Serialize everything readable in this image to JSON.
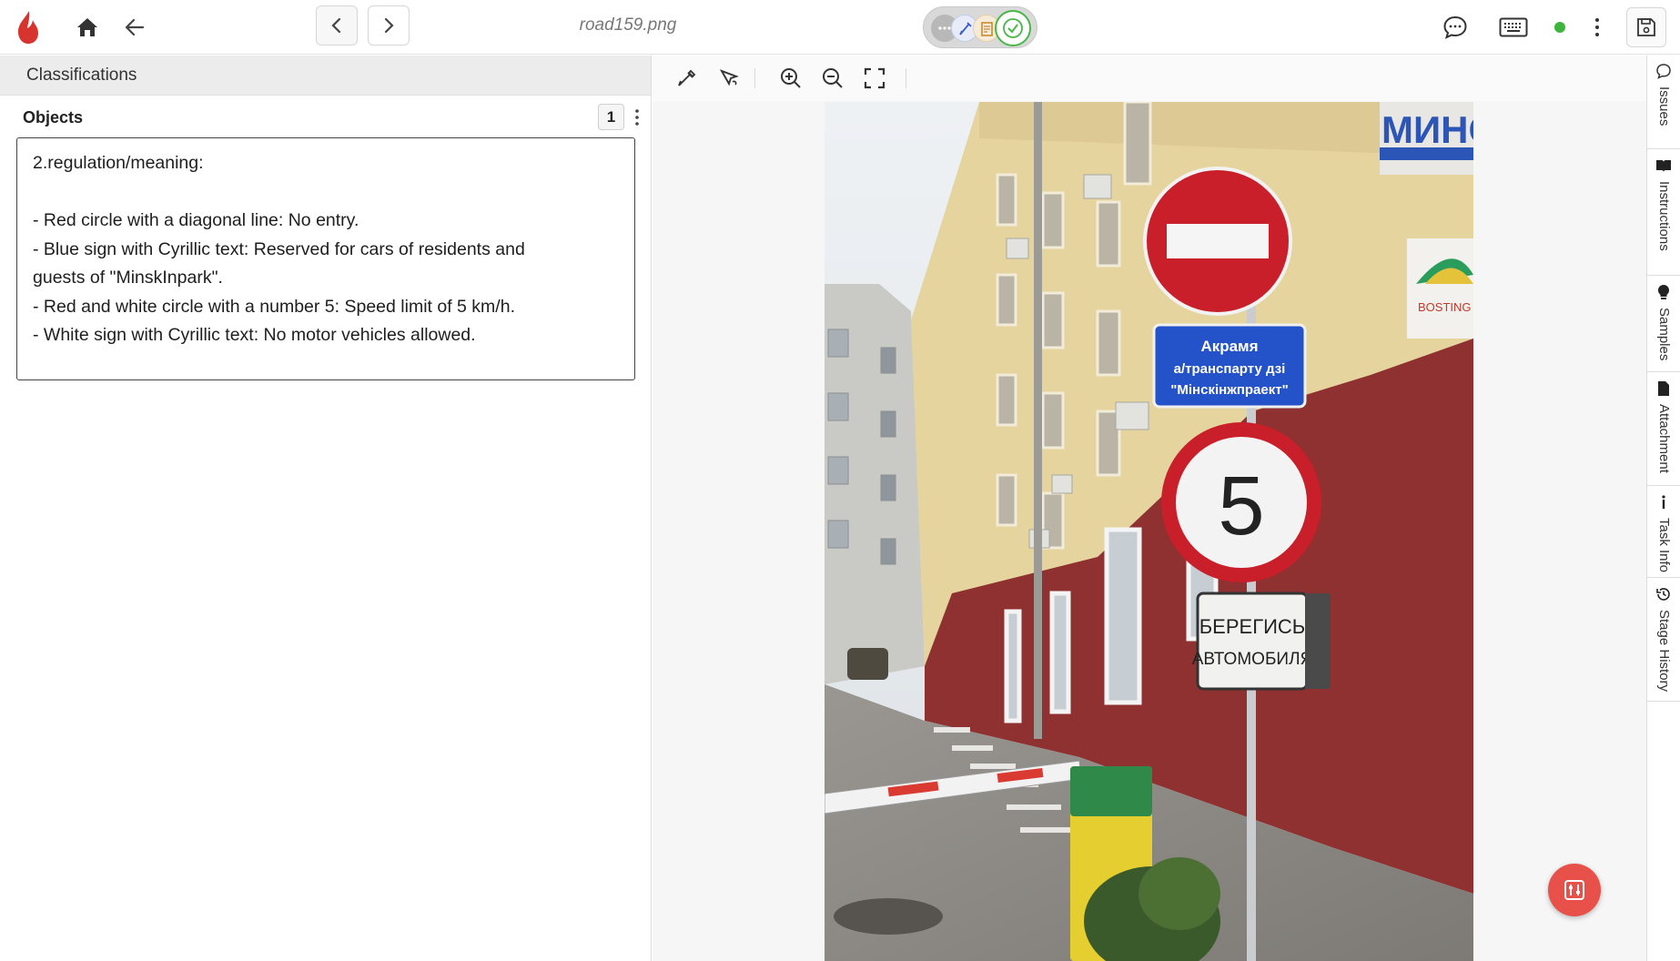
{
  "topbar": {
    "filename": "road159.png",
    "logo_icon": "flame-logo-icon",
    "colors": {
      "accent": "#e8514a",
      "online": "#3cb53c"
    }
  },
  "left_panel": {
    "section_title": "Classifications",
    "objects_label": "Objects",
    "objects_count": "1",
    "answer_lines": [
      "2.regulation/meaning:",
      "",
      "- Red circle with a diagonal line: No entry.",
      "- Blue sign with Cyrillic text: Reserved for cars of residents and",
      "guests of \"MinskInpark\".",
      "- Red and white circle with a number 5: Speed limit of 5 km/h.",
      "- White sign with Cyrillic text: No motor vehicles allowed."
    ]
  },
  "photo": {
    "store_sign": "МИНС",
    "blue_sign": [
      "Акрамя",
      "а/транспарту дзі",
      "\"Мінскінжпраект\""
    ],
    "speed_limit": "5",
    "warning_sign": [
      "БЕРЕГИСЬ",
      "АВТОМОБИЛЯ"
    ],
    "shop_logo": "BOSTING"
  },
  "side_rail": {
    "items": [
      {
        "label": "Issues",
        "icon": "chat-bubble-icon"
      },
      {
        "label": "Instructions",
        "icon": "book-icon"
      },
      {
        "label": "Samples",
        "icon": "lightbulb-icon"
      },
      {
        "label": "Attachment",
        "icon": "attachment-icon"
      },
      {
        "label": "Task Info",
        "icon": "info-icon"
      },
      {
        "label": "Stage History",
        "icon": "history-icon"
      }
    ]
  }
}
